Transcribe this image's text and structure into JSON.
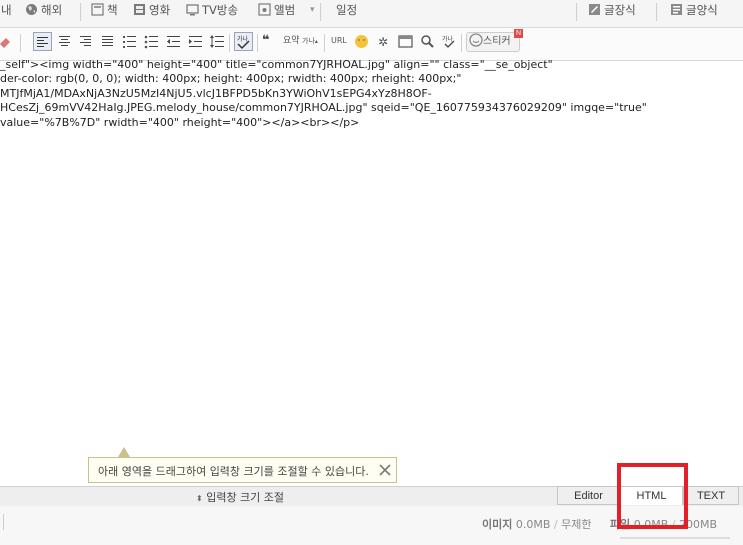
{
  "menu_bar": {
    "items": [
      {
        "label": "내",
        "icon": ""
      },
      {
        "label": "해외",
        "icon": "globe-icon"
      },
      {
        "label": "책",
        "icon": "book-icon"
      },
      {
        "label": "영화",
        "icon": "film-icon"
      },
      {
        "label": "TV방송",
        "icon": "tv-icon"
      },
      {
        "label": "앨범",
        "icon": "album-icon"
      },
      {
        "label": "일정",
        "icon": ""
      }
    ],
    "right_items": [
      {
        "label": "글장식",
        "icon": "brush-icon"
      },
      {
        "label": "글양식",
        "icon": "template-icon"
      }
    ]
  },
  "format_toolbar": {
    "quote_label": "요약",
    "small_label": "가나",
    "url_label": "URL",
    "sticker_label": "스티커",
    "sticker_badge": "N"
  },
  "code": {
    "lines": [
      "_self\"><img width=\"400\" height=\"400\" title=\"common7YJRHOAL.jpg\" align=\"\" class=\"__se_object\"",
      "der-color: rgb(0, 0, 0); width: 400px; height: 400px; rwidth: 400px; rheight: 400px;\"",
      "MTJfMjA1/MDAxNjA3NzU5MzI4NjU5.vlcJ1BFPD5bKn3YWiOhV1sEPG4xYz8H8OF-",
      "HCesZj_69mVV42HaIg.JPEG.melody_house/common7YJRHOAL.jpg\" sqeid=\"QE_1607759343760292​09\" imgqe=\"true\"",
      "value=\"%7B%7D\" rwidth=\"400\" rheight=\"400\"></a><br></p>"
    ]
  },
  "tooltip": {
    "text": "아래 영역을 드래그하여 입력창 크기를 조절할 수 있습니다.",
    "close_icon": "close-icon"
  },
  "resize": {
    "label": "입력창 크기 조절",
    "icon": "resize-icon"
  },
  "tabs": [
    {
      "label": "Editor",
      "active": false
    },
    {
      "label": "HTML",
      "active": true
    },
    {
      "label": "TEXT",
      "active": false
    }
  ],
  "status": {
    "image_label": "이미지",
    "image_value": "0.0MB",
    "unlimited_label": "무제한",
    "file_label": "파일",
    "file_value": "0.0MB",
    "file_limit": "200MB"
  },
  "colors": {
    "highlight_box": "#e3202a",
    "accent": "#3b5ea8"
  }
}
